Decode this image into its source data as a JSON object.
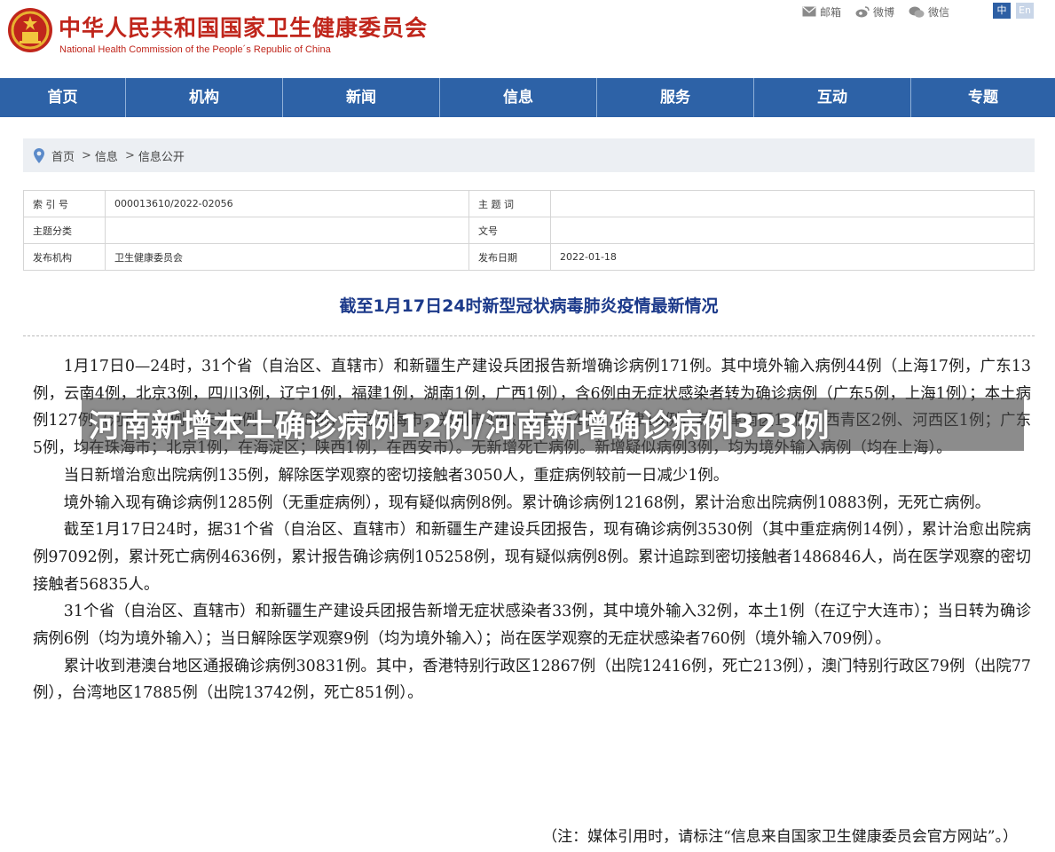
{
  "header": {
    "site_name_cn": "中华人民共和国国家卫生健康委员会",
    "site_name_en": "National Health Commission of the People´s Republic of China",
    "links": [
      "邮箱",
      "微博",
      "微信"
    ],
    "lang_zh": "中",
    "lang_en": "En"
  },
  "nav": [
    "首页",
    "机构",
    "新闻",
    "信息",
    "服务",
    "互动",
    "专题"
  ],
  "breadcrumb": [
    "首页",
    "信息",
    "信息公开"
  ],
  "meta": {
    "index_label": "索 引 号",
    "index_value": "000013610/2022-02056",
    "keyword_label": "主 题 词",
    "keyword_value": "",
    "category_label": "主题分类",
    "category_value": "",
    "doc_label": "文号",
    "doc_value": "",
    "org_label": "发布机构",
    "org_value": "卫生健康委员会",
    "date_label": "发布日期",
    "date_value": "2022-01-18"
  },
  "article": {
    "title": "截至1月17日24时新型冠状病毒肺炎疫情最新情况",
    "paragraphs": [
      "1月17日0—24时，31个省（自治区、直辖市）和新疆生产建设兵团报告新增确诊病例171例。其中境外输入病例44例（上海17例，广东13例，云南4例，北京3例，四川3例，辽宁1例，福建1例，湖南1例，广西1例），含6例由无症状感染者转为确诊病例（广东5例，上海1例）；本土病例127例（河南112例，天津8例，广东5例，均在珠海市；郑州市4例、许昌市4例；天津18例，其中津南区15例、西青区2例、河西区1例；广东5例，均在珠海市；北京1例，在海淀区；陕西1例，在西安市）。无新增死亡病例。新增疑似病例3例，均为境外输入病例（均在上海）。",
      "当日新增治愈出院病例135例，解除医学观察的密切接触者3050人，重症病例较前一日减少1例。",
      "境外输入现有确诊病例1285例（无重症病例），现有疑似病例8例。累计确诊病例12168例，累计治愈出院病例10883例，无死亡病例。",
      "截至1月17日24时，据31个省（自治区、直辖市）和新疆生产建设兵团报告，现有确诊病例3530例（其中重症病例14例），累计治愈出院病例97092例，累计死亡病例4636例，累计报告确诊病例105258例，现有疑似病例8例。累计追踪到密切接触者1486846人，尚在医学观察的密切接触者56835人。",
      "31个省（自治区、直辖市）和新疆生产建设兵团报告新增无症状感染者33例，其中境外输入32例，本土1例（在辽宁大连市）；当日转为确诊病例6例（均为境外输入）；当日解除医学观察9例（均为境外输入）；尚在医学观察的无症状感染者760例（境外输入709例）。",
      "累计收到港澳台地区通报确诊病例30831例。其中，香港特别行政区12867例（出院12416例，死亡213例），澳门特别行政区79例（出院77例），台湾地区17885例（出院13742例，死亡851例）。"
    ],
    "note": "（注：媒体引用时，请标注“信息来自国家卫生健康委员会官方网站”。）"
  },
  "overlay": {
    "text": "河南新增本土确诊病例12例/河南新增确诊病例323例"
  },
  "colors": {
    "brand_red": "#c0261c",
    "nav_blue": "#2d62a7",
    "title_blue": "#1c3a8a"
  }
}
